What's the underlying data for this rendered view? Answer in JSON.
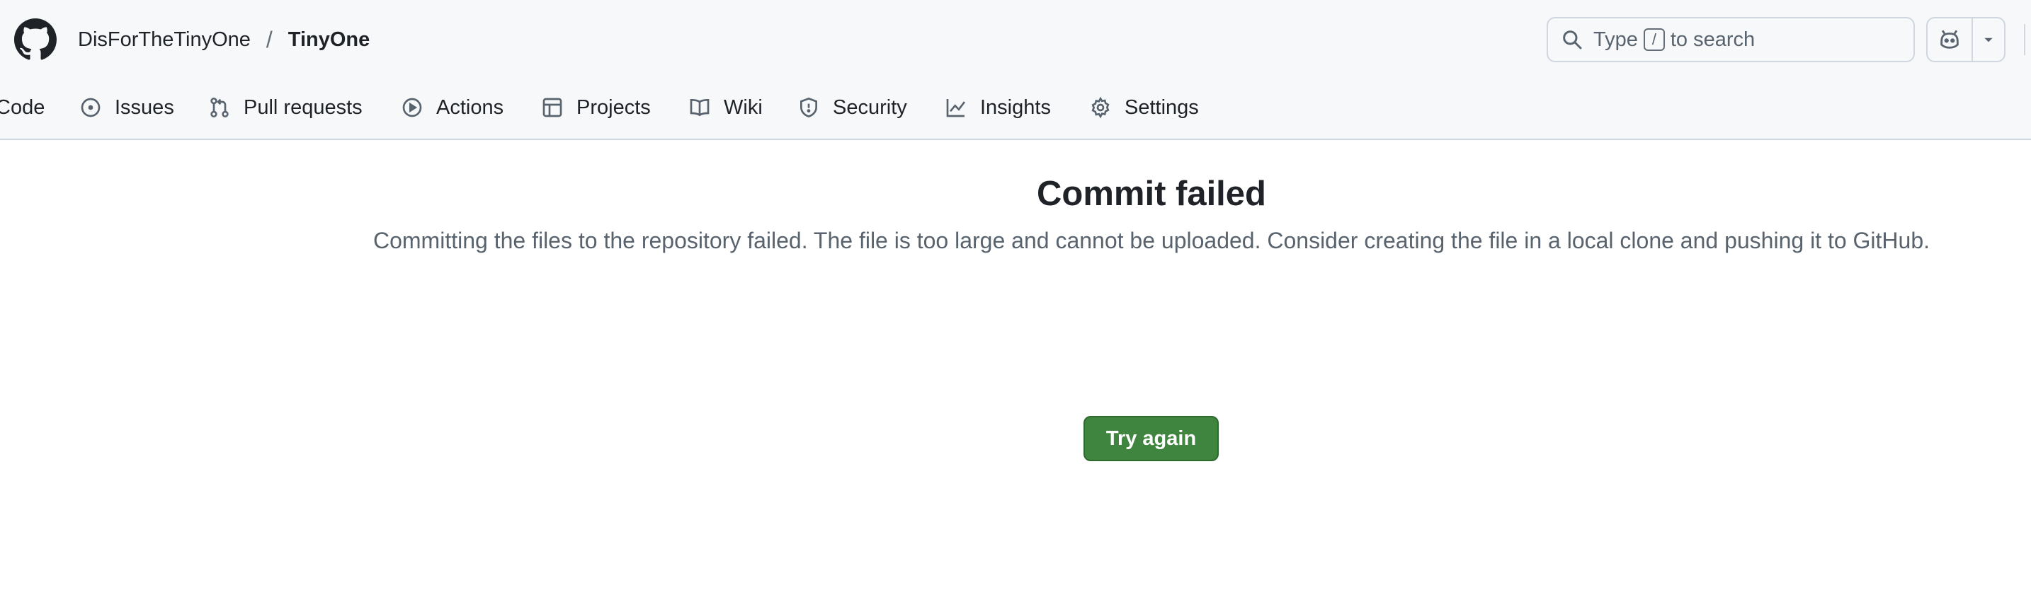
{
  "header": {
    "owner": "DisForTheTinyOne",
    "separator": "/",
    "repo": "TinyOne",
    "search": {
      "prefix": "Type",
      "key": "/",
      "suffix": "to search"
    }
  },
  "tabs": [
    {
      "label": "Code",
      "icon": "code-icon"
    },
    {
      "label": "Issues",
      "icon": "issue-opened-icon"
    },
    {
      "label": "Pull requests",
      "icon": "git-pull-request-icon"
    },
    {
      "label": "Actions",
      "icon": "play-icon"
    },
    {
      "label": "Projects",
      "icon": "table-icon"
    },
    {
      "label": "Wiki",
      "icon": "book-icon"
    },
    {
      "label": "Security",
      "icon": "shield-icon"
    },
    {
      "label": "Insights",
      "icon": "graph-icon"
    },
    {
      "label": "Settings",
      "icon": "gear-icon"
    }
  ],
  "message": {
    "title": "Commit failed",
    "description": "Committing the files to the repository failed. The file is too large and cannot be uploaded. Consider creating the file in a local clone and pushing it to GitHub.",
    "button": "Try again"
  },
  "colors": {
    "primary_button": "#3f843f",
    "header_bg": "#f6f8fa",
    "border": "#d0d7de"
  }
}
